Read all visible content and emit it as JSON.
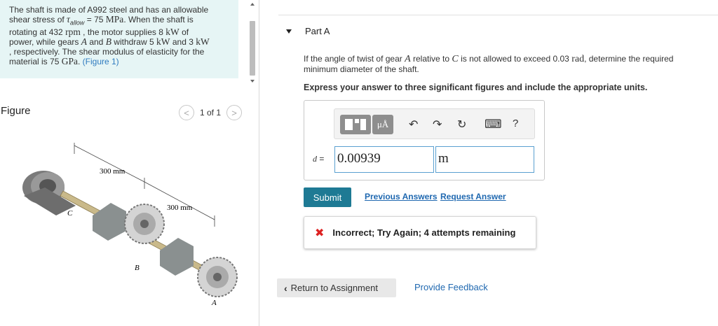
{
  "problem": {
    "t1": "The shaft is made of A992 steel and has an allowable",
    "t2": "shear stress of",
    "tau": "τ",
    "tau_sub": "allow",
    "t3": "= 75",
    "mpa": "MPa",
    "t4": ". When the shaft is",
    "t5": "rotating at 432",
    "rpm": "rpm",
    "t6": ", the motor supplies 8",
    "kw1": "kW",
    "t7": "of",
    "t8": "power, while gears",
    "gearA": "A",
    "t9": "and",
    "gearB": "B",
    "t10": "withdraw 5",
    "kw2": "kW",
    "t11": "and 3",
    "kw3": "kW",
    "t12": ", respectively. The shear modulus of elasticity for the",
    "t13": "material is 75",
    "gpa": "GPa",
    "t14": ".",
    "fig_link": "(Figure 1)"
  },
  "figure": {
    "title": "Figure",
    "pager": "1 of 1",
    "prev": "<",
    "next": ">",
    "dim1": "300 mm",
    "dim2": "300 mm",
    "label_c": "C",
    "label_b": "B",
    "label_a": "A"
  },
  "part": {
    "title": "Part A",
    "q1": "If the angle of twist of gear",
    "qA": "A",
    "q2": "relative to",
    "qC": "C",
    "q3": "is not allowed to exceed 0.03",
    "qrad": "rad",
    "q4": ", determine the required",
    "q5": "minimum diameter of the shaft.",
    "instruction": "Express your answer to three significant figures and include the appropriate units."
  },
  "toolbar": {
    "unit_label": "μÅ",
    "undo_icon": "↶",
    "redo_icon": "↷",
    "reset_icon": "↻",
    "keyboard_icon": "⌨",
    "help": "?"
  },
  "answer": {
    "label_var": "d",
    "label_eq": "=",
    "value": "0.00939",
    "unit": "m"
  },
  "actions": {
    "submit": "Submit",
    "previous": "Previous Answers",
    "request": "Request Answer",
    "feedback_icon": "✖",
    "feedback": "Incorrect; Try Again; 4 attempts remaining",
    "return": "Return to Assignment",
    "return_icon": "‹",
    "provide": "Provide Feedback"
  },
  "colors": {
    "problem_bg": "#e6f5f5",
    "submit_bg": "#1e7a94",
    "link": "#1f68b0",
    "error": "#dd2222"
  }
}
